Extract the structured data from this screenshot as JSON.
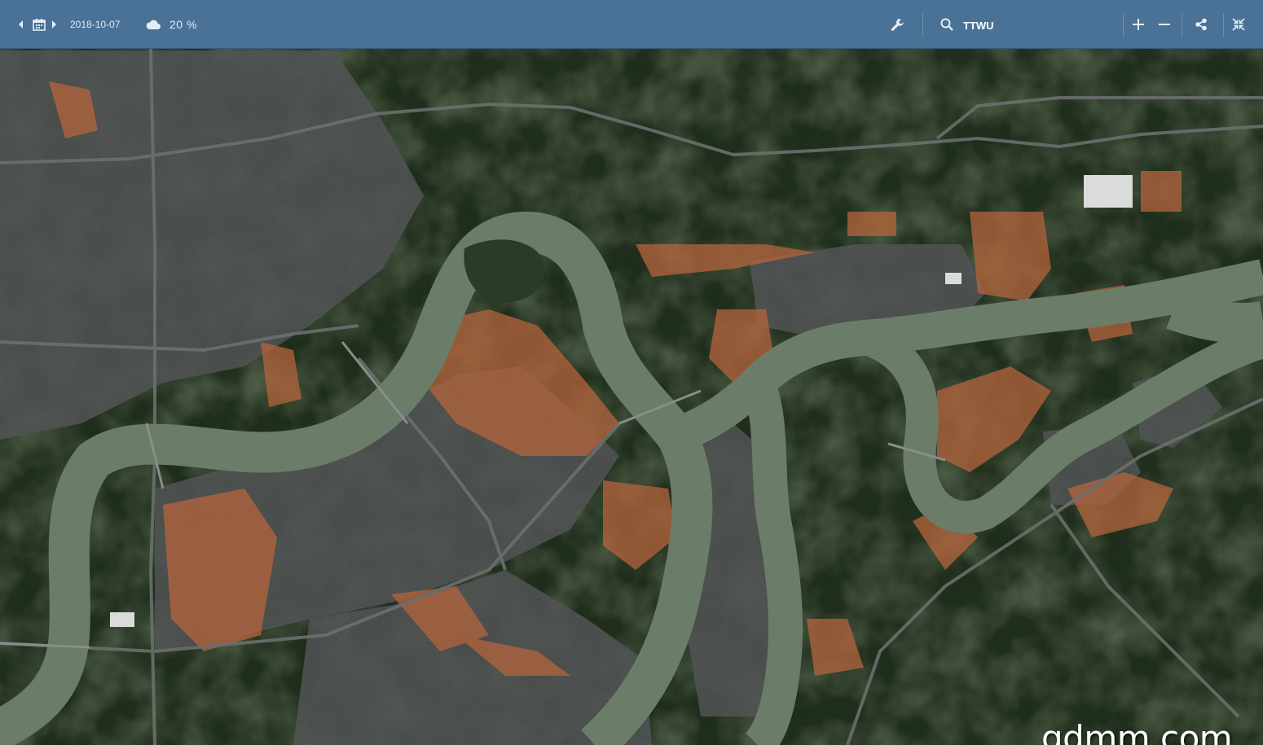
{
  "toolbar": {
    "date": "2018-10-07",
    "cloud_cover": "20 %",
    "search": {
      "value": "TTWU"
    },
    "icons": {
      "prev": "chevron-left-icon",
      "calendar": "calendar-icon",
      "next": "chevron-right-icon",
      "cloud": "cloud-icon",
      "tools": "wrench-icon",
      "search": "search-icon",
      "zoom_in": "plus-icon",
      "zoom_out": "minus-icon",
      "share": "share-icon",
      "layers": "collapse-icon"
    },
    "colors": {
      "bar": "#4a7196",
      "text": "#e3ebf3"
    }
  },
  "map": {
    "type": "satellite-imagery",
    "colors": {
      "river": "#6b7d68",
      "vegetation": "#23331f",
      "urban": "#585b5c",
      "soil": "#b5643c"
    }
  },
  "watermark": "gdmm.com"
}
